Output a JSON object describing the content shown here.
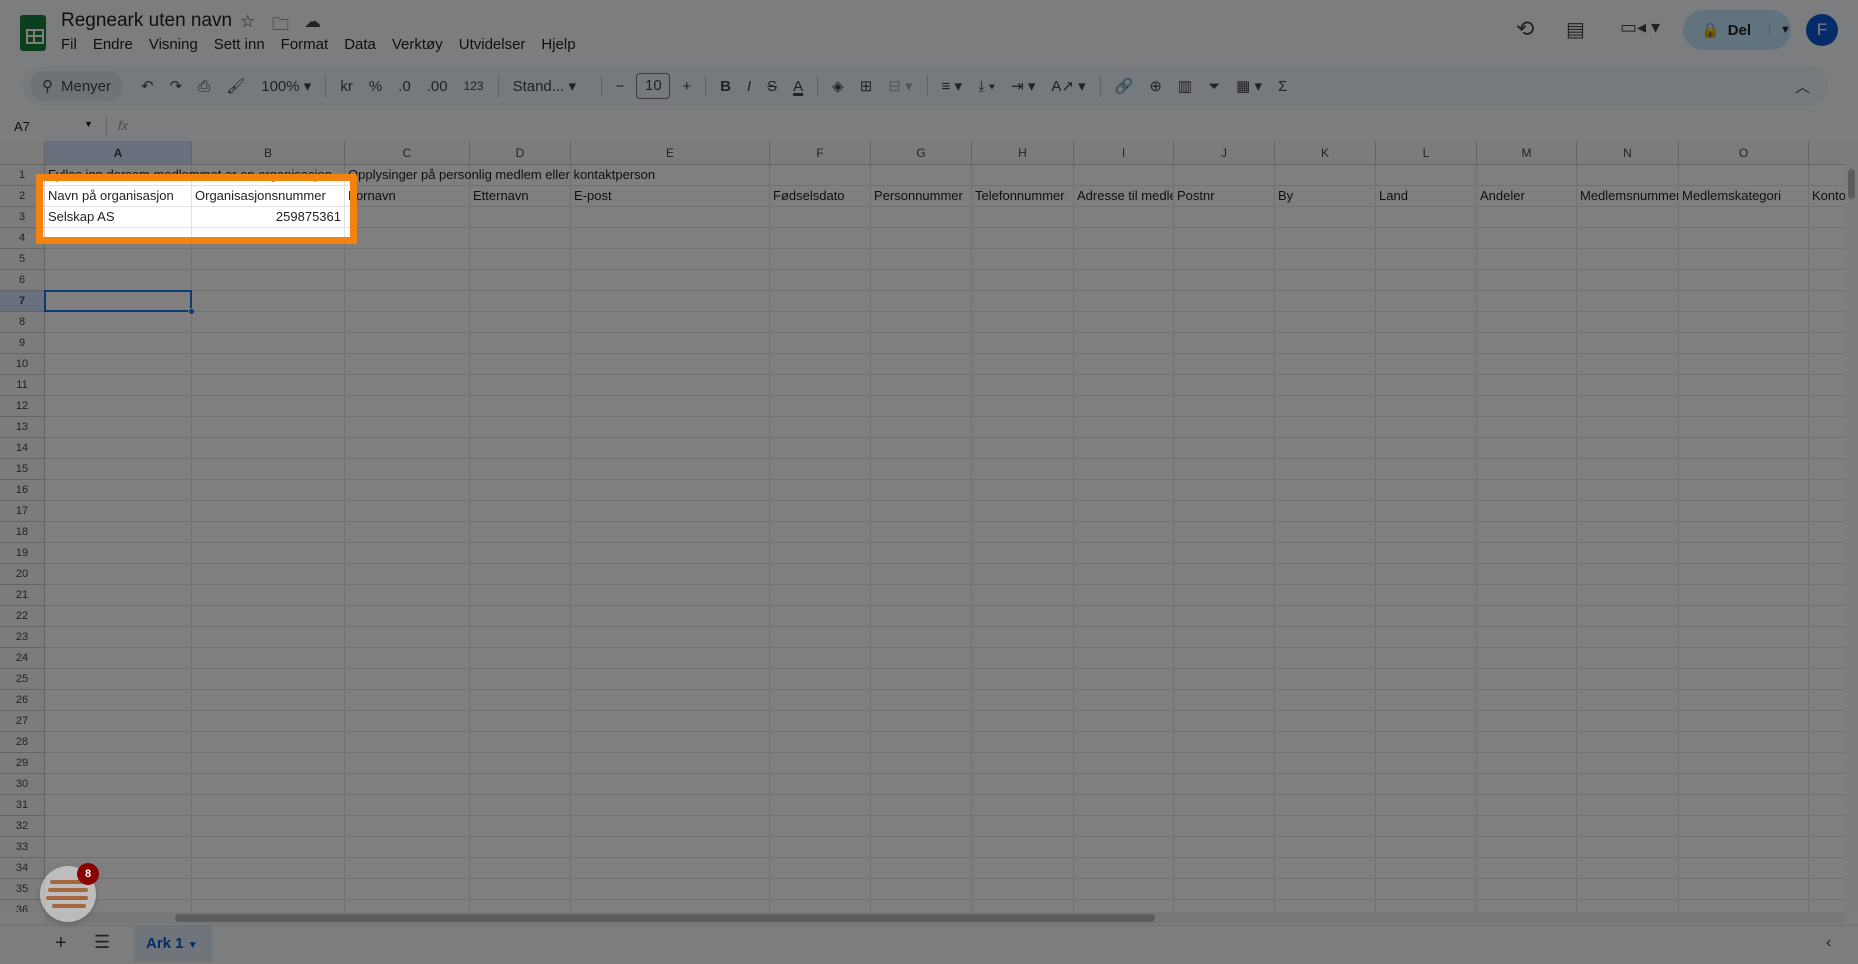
{
  "app": {
    "title": "Regneark uten navn",
    "menu": [
      "Fil",
      "Endre",
      "Visning",
      "Sett inn",
      "Format",
      "Data",
      "Verktøy",
      "Utvidelser",
      "Hjelp"
    ],
    "share_label": "Del",
    "avatar_letter": "F"
  },
  "toolbar": {
    "search": "Menyer",
    "zoom": "100%",
    "currency": "kr",
    "percent": "%",
    "dec_less": ".0",
    "dec_more": ".00",
    "number_format": "123",
    "font": "Stand...",
    "font_size": "10"
  },
  "formula_bar": {
    "cell_ref": "A7",
    "fx": "fx",
    "value": ""
  },
  "columns": [
    "A",
    "B",
    "C",
    "D",
    "E",
    "F",
    "G",
    "H",
    "I",
    "J",
    "K",
    "L",
    "M",
    "N",
    "O",
    ""
  ],
  "row_count": 36,
  "cells": {
    "A1": "Fylles inn dersom medlemmet er en organisasjon",
    "C1": "Opplysinger på personlig medlem eller kontaktperson",
    "A2": "Navn på organisasjon",
    "B2": "Organisasjonsnummer",
    "C2": "Fornavn",
    "D2": "Etternavn",
    "E2": "E-post",
    "F2": "Fødselsdato",
    "G2": "Personnummer",
    "H2": "Telefonnummer",
    "I2": "Adresse til medlem",
    "J2": "Postnr",
    "K2": "By",
    "L2": "Land",
    "M2": "Andeler",
    "N2": "Medlemsnummer",
    "O2": "Medlemskategori",
    "P2": "Konto",
    "A3": "Selskap AS",
    "B3": "259875361"
  },
  "selected_cell": "A7",
  "sheets": [
    {
      "name": "Ark 1",
      "active": true
    }
  ],
  "notification_badge": "8",
  "colors": {
    "highlight": "#f5820d",
    "accent": "#1a73e8",
    "sheets_green": "#188038"
  }
}
